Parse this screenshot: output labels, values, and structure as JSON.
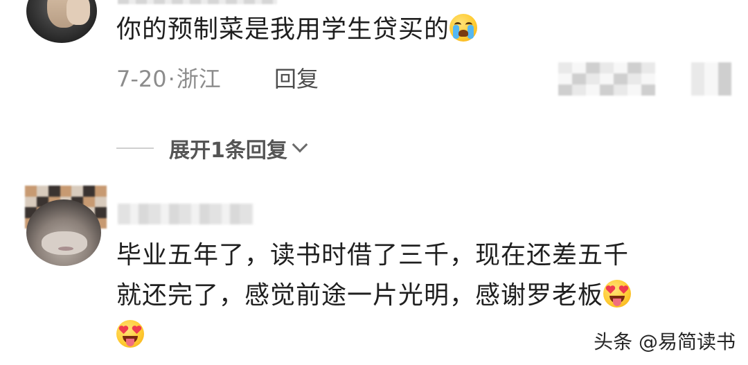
{
  "comment1": {
    "text": "你的预制菜是我用学生贷买的",
    "emoji": "loudly-crying-face-icon",
    "date": "7-20",
    "separator": "·",
    "location": "浙江",
    "reply_label": "回复",
    "expand_label": "展开1条回复"
  },
  "comment2": {
    "line1": "毕业五年了，读书时借了三千，现在还差五千",
    "line2": "就还完了，感觉前途一片光明，感谢罗老板",
    "emoji": "heart-eyes-tongue-face-icon"
  },
  "watermark": "头条 @易简读书",
  "colors": {
    "text_primary": "#1f1f1f",
    "text_meta": "#8c8c8c",
    "text_reply": "#4d4d4d",
    "emoji_yellow": "#ffcc33",
    "tear_blue": "#54b7f2"
  }
}
